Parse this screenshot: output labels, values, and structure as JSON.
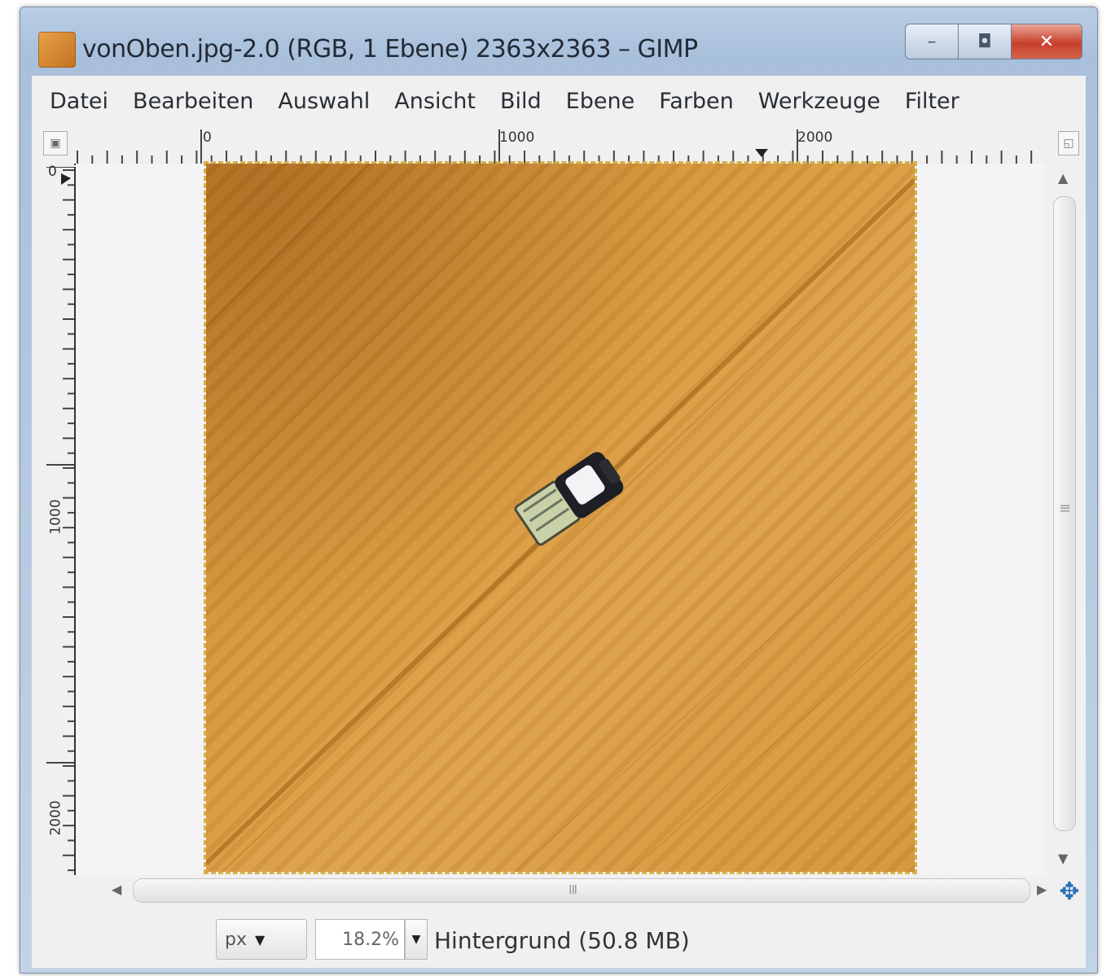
{
  "window": {
    "title": "vonOben.jpg-2.0 (RGB, 1 Ebene) 2363x2363 – GIMP",
    "controls": {
      "minimize": "–",
      "maximize": "◘",
      "close": "✕"
    }
  },
  "menubar": {
    "items": [
      "Datei",
      "Bearbeiten",
      "Auswahl",
      "Ansicht",
      "Bild",
      "Ebene",
      "Farben",
      "Werkzeuge",
      "Filter"
    ]
  },
  "rulers": {
    "horizontal_labels": [
      "0",
      "1000",
      "2000"
    ],
    "vertical_labels": [
      "0",
      "1000",
      "2000"
    ]
  },
  "canvas": {
    "image_subject": "aerial view of harvester on wheat field",
    "field_color": "#d3923a"
  },
  "statusbar": {
    "unit": "px",
    "zoom": "18.2%",
    "layer_info": "Hintergrund (50.8 MB)"
  }
}
